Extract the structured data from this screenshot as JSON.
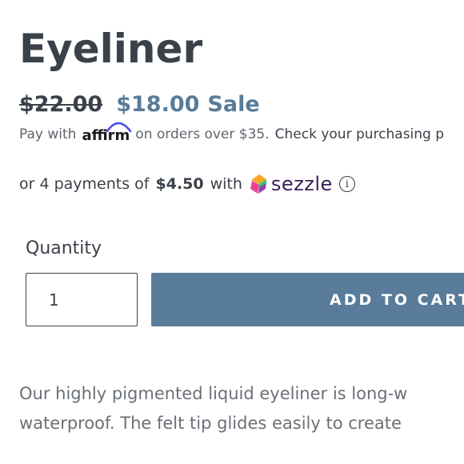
{
  "product": {
    "title": "Eyeliner",
    "price_original": "$22.00",
    "price_sale": "$18.00",
    "sale_label": "Sale"
  },
  "affirm": {
    "prefix": "Pay with",
    "logo_text": "affirm",
    "suffix": "on orders over $35.",
    "link_text": "Check your purchasing p",
    "brand_color": "#4a4af4"
  },
  "sezzle": {
    "prefix": "or 4 payments of",
    "amount": "$4.50",
    "with": "with",
    "logo_text": "sezzle",
    "icon": "info-icon",
    "brand_color": "#38205a"
  },
  "quantity": {
    "label": "Quantity",
    "value": "1"
  },
  "cart": {
    "button_label": "ADD TO CART"
  },
  "description": {
    "lines": [
      "Our highly pigmented liquid eyeliner is long-w",
      "waterproof. The felt tip glides easily to create"
    ]
  },
  "colors": {
    "accent": "#587c99",
    "text": "#3a4149"
  }
}
